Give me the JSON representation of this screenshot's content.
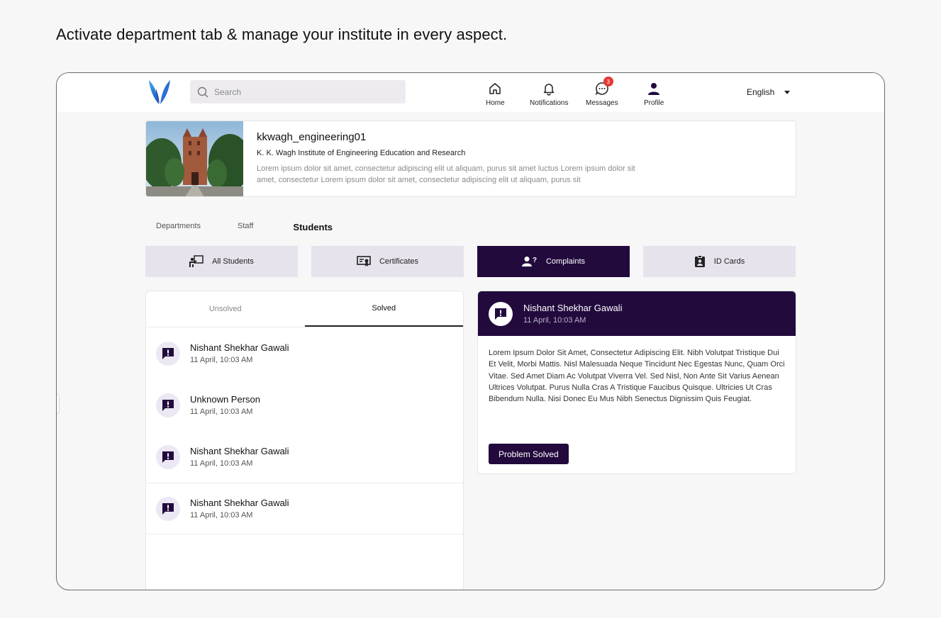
{
  "headline": "Activate department tab & manage your institute in every aspect.",
  "search": {
    "placeholder": "Search"
  },
  "nav": {
    "home": "Home",
    "notifications": "Notifications",
    "messages": "Messages",
    "messages_badge": "3",
    "profile": "Profile"
  },
  "language": "English",
  "institute": {
    "username": "kkwagh_engineering01",
    "name": "K. K. Wagh Institute of Engineering Education and Research",
    "description_line1": "Lorem ipsum dolor sit amet, consectetur adipiscing elit ut aliquam, purus sit amet luctus Lorem ipsum dolor sit",
    "description_line2": "amet, consectetur Lorem ipsum dolor sit amet, consectetur adipiscing elit ut aliquam, purus sit"
  },
  "subtabs": [
    "Departments",
    "Staff",
    "Students"
  ],
  "categories": [
    "All Students",
    "Certificates",
    "Complaints",
    "ID Cards"
  ],
  "list_tabs": {
    "unsolved": "Unsolved",
    "solved": "Solved"
  },
  "complaints": [
    {
      "name": "Nishant Shekhar Gawali",
      "time": "11 April, 10:03 AM"
    },
    {
      "name": "Unknown Person",
      "time": "11 April, 10:03 AM"
    },
    {
      "name": "Nishant Shekhar Gawali",
      "time": "11 April, 10:03 AM"
    },
    {
      "name": "Nishant Shekhar Gawali",
      "time": "11 April, 10:03 AM"
    }
  ],
  "detail": {
    "name": "Nishant Shekhar Gawali",
    "time": "11 April, 10:03 AM",
    "body": "Lorem Ipsum Dolor Sit Amet, Consectetur Adipiscing Elit. Nibh Volutpat Tristique Dui Et Velit, Morbi Mattis. Nisl Malesuada Neque Tincidunt Nec Egestas Nunc, Quam Orci Vitae. Sed Amet Diam Ac Volutpat Viverra Vel. Sed Nisl, Non Ante Sit Varius Aenean Ultrices Volutpat. Purus Nulla Cras A Tristique Faucibus Quisque. Ultricies Ut Cras Bibendum Nulla. Nisi Donec Eu Mus Nibh Senectus Dignissim Quis Feugiat.",
    "button": "Problem Solved"
  },
  "colors": {
    "accent": "#220a3d",
    "badge": "#e53935",
    "tab_bg": "#e6e3ec"
  }
}
